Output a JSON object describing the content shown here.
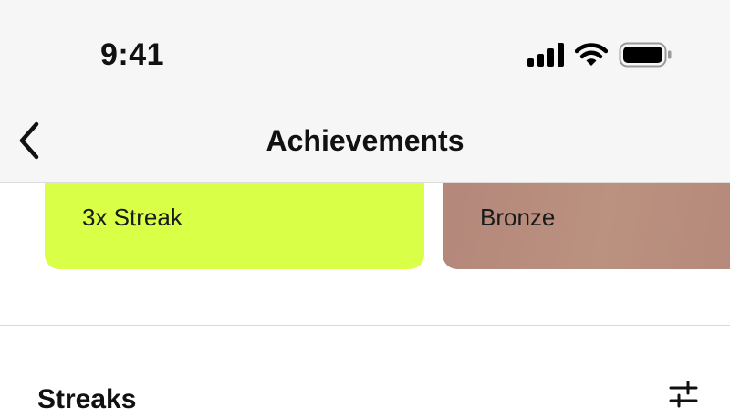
{
  "status_bar": {
    "time": "9:41",
    "icons": [
      "cellular-signal-icon",
      "wifi-icon",
      "battery-icon"
    ]
  },
  "nav": {
    "title": "Achievements",
    "back_icon": "chevron-left-icon"
  },
  "achievements": [
    {
      "label": "3x Streak",
      "color": "#d9ff47"
    },
    {
      "label": "Bronze",
      "color": "#b8897a"
    }
  ],
  "streaks_section": {
    "title": "Streaks",
    "filter_icon": "sliders-icon"
  }
}
